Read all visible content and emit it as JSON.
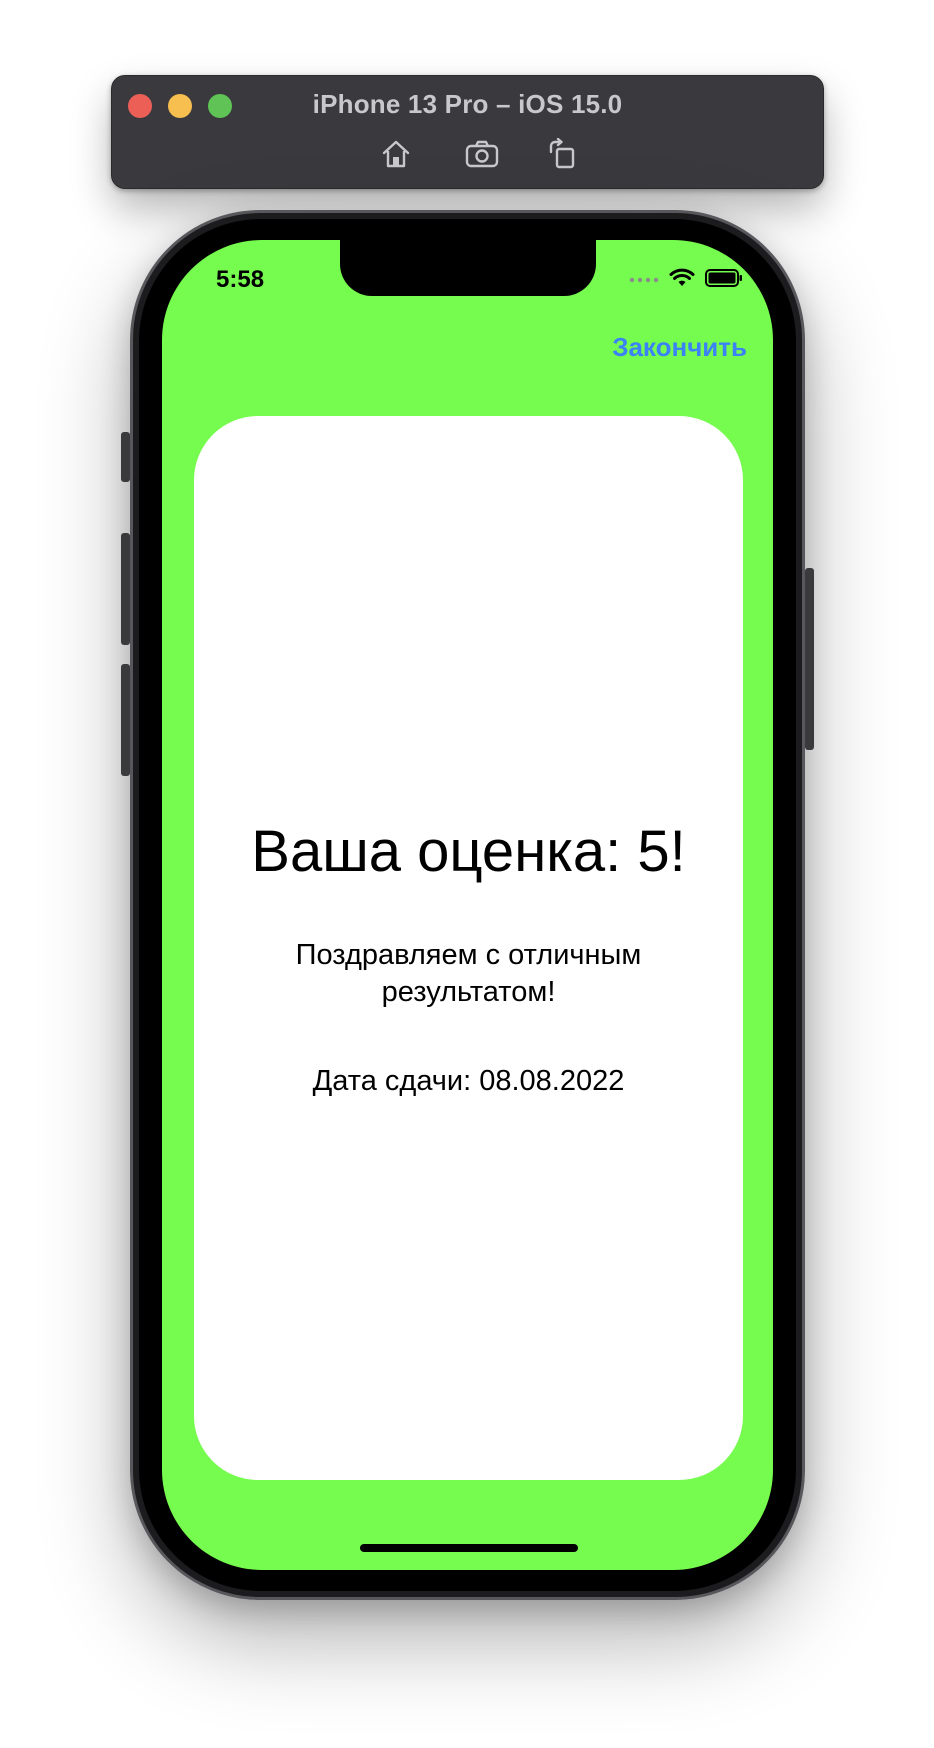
{
  "simulator": {
    "title": "iPhone 13 Pro – iOS 15.0",
    "tools": [
      "home-icon",
      "screenshot-icon",
      "rotate-icon"
    ]
  },
  "status_bar": {
    "time": "5:58",
    "icons": [
      "cellular-icon",
      "wifi-icon",
      "battery-icon"
    ]
  },
  "nav": {
    "action_label": "Закончить"
  },
  "result": {
    "grade": "Ваша оценка: 5!",
    "message": "Поздравляем с отличным результатом!",
    "date": "Дата сдачи: 08.08.2022"
  },
  "colors": {
    "screen_background": "#76fb4f",
    "accent": "#3b82f6",
    "card_background": "#ffffff"
  }
}
